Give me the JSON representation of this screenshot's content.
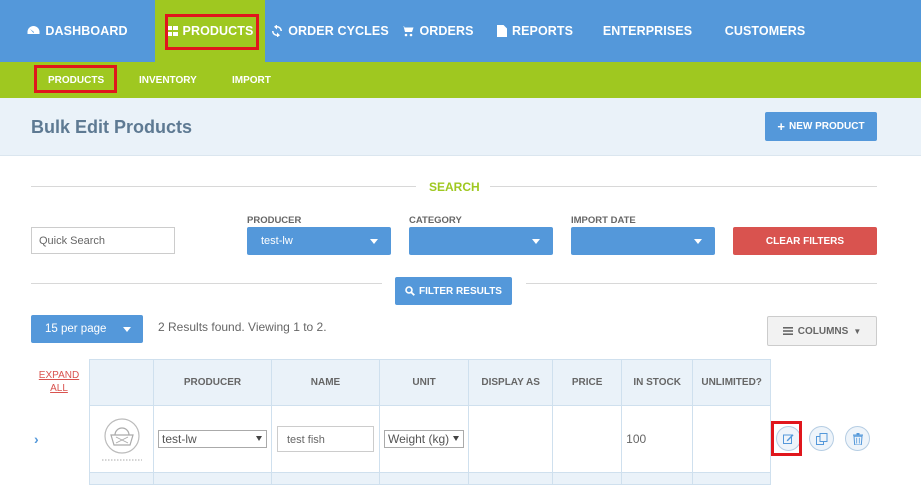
{
  "nav": {
    "items": [
      {
        "label": "DASHBOARD",
        "icon": "dashboard-icon"
      },
      {
        "label": "PRODUCTS",
        "icon": "grid-icon"
      },
      {
        "label": "ORDER CYCLES",
        "icon": "refresh-icon"
      },
      {
        "label": "ORDERS",
        "icon": "cart-icon"
      },
      {
        "label": "REPORTS",
        "icon": "file-icon"
      },
      {
        "label": "ENTERPRISES"
      },
      {
        "label": "CUSTOMERS"
      }
    ],
    "active": "PRODUCTS"
  },
  "subnav": {
    "items": [
      {
        "label": "PRODUCTS"
      },
      {
        "label": "INVENTORY"
      },
      {
        "label": "IMPORT"
      }
    ],
    "active": "PRODUCTS"
  },
  "header": {
    "title": "Bulk Edit Products",
    "new_product_label": "NEW PRODUCT"
  },
  "search": {
    "section_label": "SEARCH",
    "quick_search_placeholder": "Quick Search",
    "producer_label": "PRODUCER",
    "producer_value": "test-lw",
    "category_label": "CATEGORY",
    "category_value": "",
    "import_date_label": "IMPORT DATE",
    "import_date_value": "",
    "clear_filters_label": "CLEAR FILTERS",
    "filter_results_label": "FILTER RESULTS"
  },
  "listing": {
    "per_page": "15 per page",
    "results_text": "2 Results found. Viewing 1 to 2.",
    "columns_label": "COLUMNS",
    "expand_all_line1": "EXPAND",
    "expand_all_line2": "ALL"
  },
  "table": {
    "headers": [
      "PRODUCER",
      "NAME",
      "UNIT",
      "DISPLAY AS",
      "PRICE",
      "IN STOCK",
      "UNLIMITED?"
    ],
    "rows": [
      {
        "producer": "test-lw",
        "name": "test fish",
        "unit": "Weight (kg)",
        "display_as": "",
        "price": "",
        "in_stock": "100",
        "unlimited": ""
      }
    ]
  },
  "colors": {
    "nav_blue": "#5498da",
    "active_green": "#9fc820",
    "danger_red": "#d9534f",
    "highlight_red": "#e0161c"
  }
}
